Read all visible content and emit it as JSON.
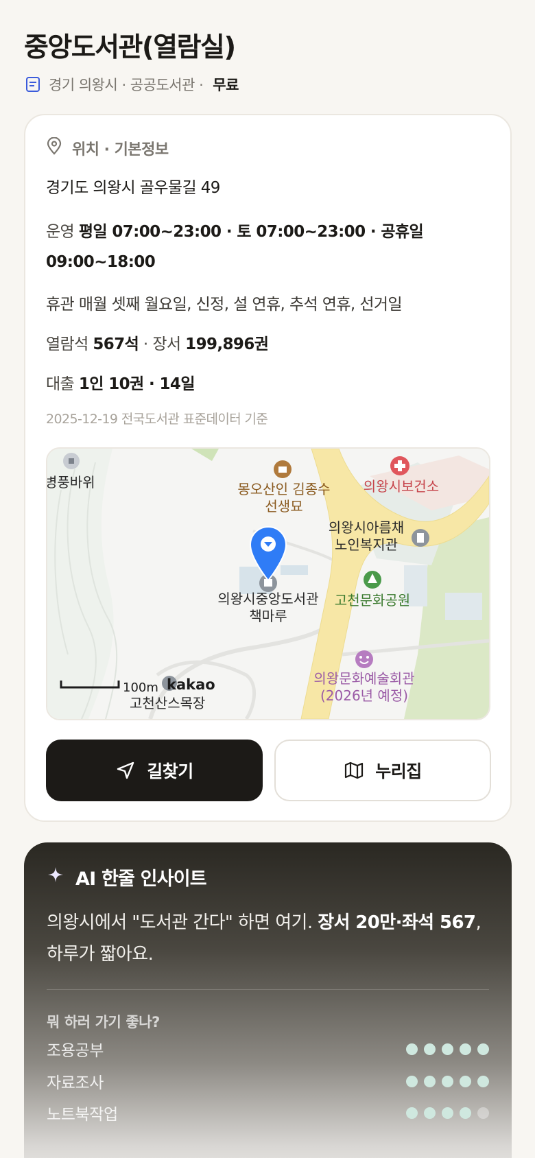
{
  "header": {
    "title": "중앙도서관(열람실)",
    "subline": "경기 의왕시 · 공공도서관 ·",
    "fee": "무료",
    "icon": "document-icon"
  },
  "info": {
    "section_title": "위치 · 기본정보",
    "section_icon": "location-pin-icon",
    "address": "경기도 의왕시 골우물길 49",
    "hours_label": "운영",
    "hours_value": "평일 07:00~23:00 · 토 07:00~23:00 · 공휴일 09:00~18:00",
    "closed": "휴관 매월 셋째 월요일, 신정, 설 연휴, 추석 연휴, 선거일",
    "seats_label": "열람석",
    "seats_value": "567석",
    "books_label": "· 장서",
    "books_value": "199,896권",
    "loan_label": "대출",
    "loan_value": "1인 10권 · 14일",
    "data_date": "2025-12-19 전국도서관 표준데이터 기준"
  },
  "map": {
    "labels": {
      "rock": "병풍바위",
      "tomb_1": "몽오산인 김종수",
      "tomb_2": "선생묘",
      "health": "의왕시보건소",
      "welfare_1": "의왕시아름채",
      "welfare_2": "노인복지관",
      "library_1": "의왕시중앙도서관",
      "library_2": "책마루",
      "park": "고천문화공원",
      "arts_1": "의왕문화예술회관",
      "arts_2": "(2026년 예정)",
      "scale": "100m",
      "brand": "kakao",
      "bottom_place": "고천산스목장"
    },
    "colors": {
      "road": "#f7e7a6",
      "park": "#dbe8c6",
      "pin": "#2f7cf6"
    }
  },
  "actions": {
    "directions_label": "길찾기",
    "nurizip_label": "누리집"
  },
  "ai": {
    "title": "AI 한줄 인사이트",
    "text_plain": "의왕시에서 \"도서관 간다\" 하면 여기. ",
    "text_bold": "장서 20만·좌석 567",
    "text_end": ", 하루가 짧아요.",
    "question": "뭐 하러 가기 좋나?",
    "items": [
      {
        "name": "조용공부",
        "score": 5
      },
      {
        "name": "자료조사",
        "score": 5
      },
      {
        "name": "노트북작업",
        "score": 4
      }
    ]
  }
}
